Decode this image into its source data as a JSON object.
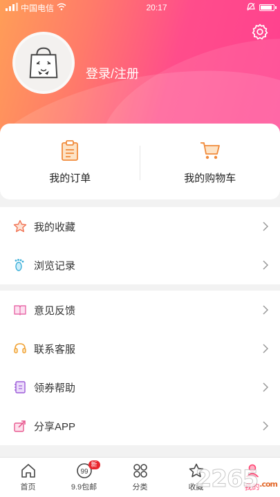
{
  "status": {
    "carrier": "中国电信",
    "time": "20:17"
  },
  "profile": {
    "login_text": "登录/注册"
  },
  "orders": [
    {
      "label": "我的订单",
      "icon": "clipboard-icon"
    },
    {
      "label": "我的购物车",
      "icon": "cart-icon"
    }
  ],
  "list1": [
    {
      "label": "我的收藏",
      "icon": "star-icon"
    },
    {
      "label": "浏览记录",
      "icon": "footprint-icon"
    }
  ],
  "list2": [
    {
      "label": "意见反馈",
      "icon": "book-icon"
    },
    {
      "label": "联系客服",
      "icon": "headset-icon"
    },
    {
      "label": "领券帮助",
      "icon": "notebook-icon"
    },
    {
      "label": "分享APP",
      "icon": "share-icon"
    }
  ],
  "tabs": [
    {
      "label": "首页",
      "icon": "home-icon"
    },
    {
      "label": "9.9包邮",
      "icon": "99-icon",
      "badge": "新"
    },
    {
      "label": "分类",
      "icon": "grid-icon"
    },
    {
      "label": "收藏",
      "icon": "star-icon"
    },
    {
      "label": "我的",
      "icon": "profile-icon",
      "active": true
    }
  ],
  "watermark": {
    "text": "2265",
    "suffix": ".com"
  },
  "colors": {
    "accent": "#ff3f6f",
    "gradient_start": "#ff9e57",
    "gradient_end": "#ff3f8f"
  }
}
